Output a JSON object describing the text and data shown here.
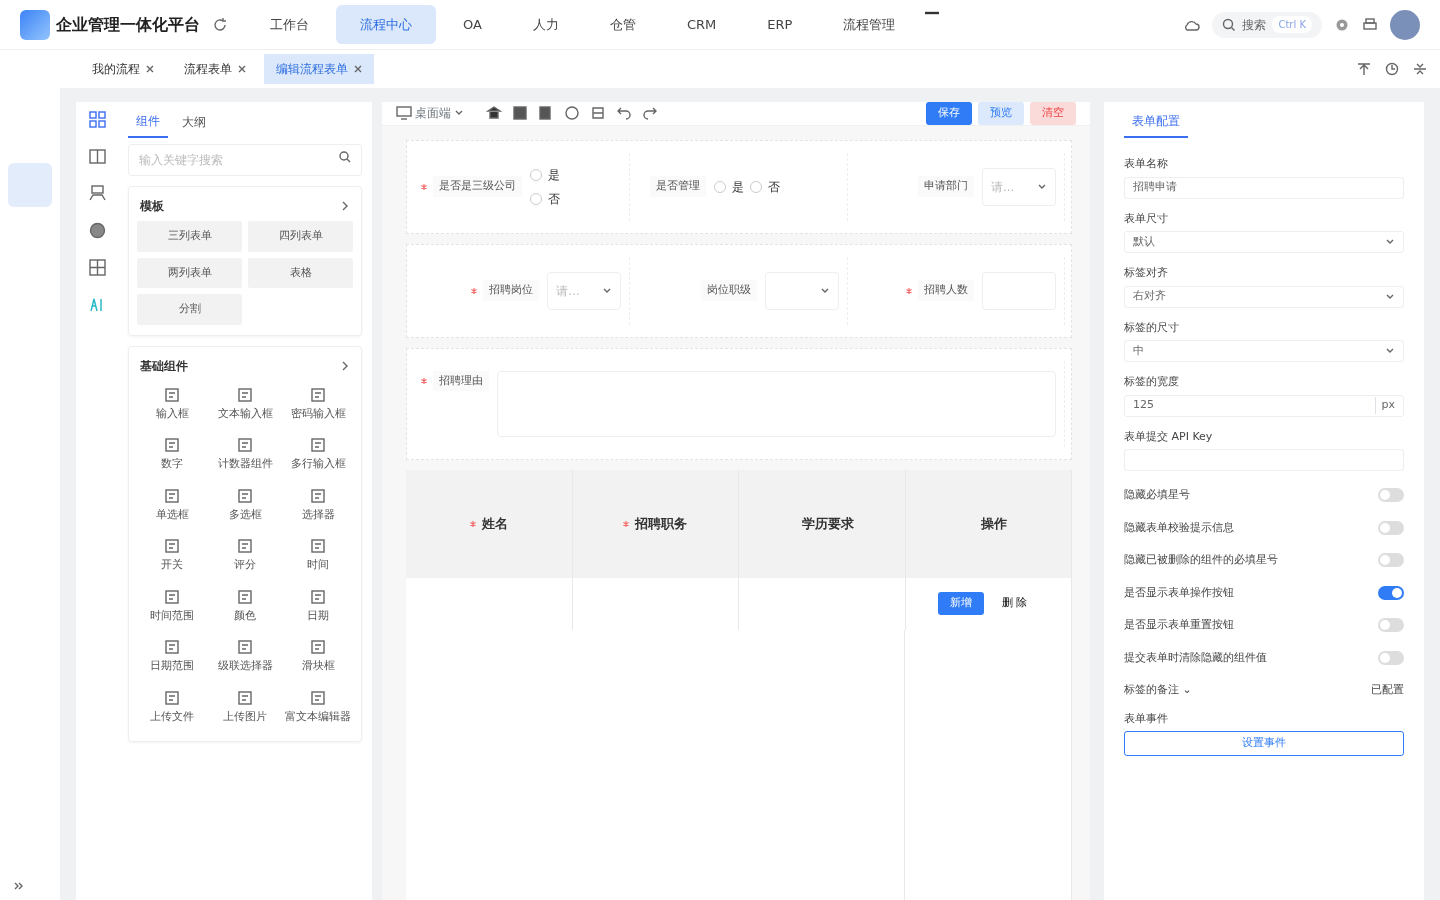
{
  "header": {
    "title": "企业管理一体化平台",
    "nav": [
      {
        "label": "工作台",
        "selected": false
      },
      {
        "label": "流程中心",
        "selected": true
      },
      {
        "label": "OA",
        "selected": false
      },
      {
        "label": "人力",
        "selected": false
      },
      {
        "label": "仓管",
        "selected": false
      },
      {
        "label": "CRM",
        "selected": false
      },
      {
        "label": "ERP",
        "selected": false
      },
      {
        "label": "流程管理",
        "selected": false
      }
    ],
    "search": {
      "placeholder": "搜索",
      "shortcut": "Ctrl K"
    }
  },
  "page_tabs": [
    {
      "label": "我的流程",
      "selected": false
    },
    {
      "label": "流程表单",
      "selected": false
    },
    {
      "label": "编辑流程表单",
      "selected": true
    }
  ],
  "components_panel": {
    "tabs": [
      {
        "label": "组件",
        "selected": true
      },
      {
        "label": "大纲",
        "selected": false
      }
    ],
    "search": {
      "placeholder": "输入关键字搜索"
    },
    "sections": [
      {
        "title": "模板",
        "kind": "buttons",
        "items": [
          "三列表单",
          "四列表单",
          "两列表单",
          "表格",
          "分割"
        ]
      },
      {
        "title": "基础组件",
        "kind": "icons",
        "items": [
          "输入框",
          "文本输入框",
          "密码输入框",
          "数字",
          "计数器组件",
          "多行输入框",
          "单选框",
          "多选框",
          "选择器",
          "开关",
          "评分",
          "时间",
          "时间范围",
          "颜色",
          "日期",
          "日期范围",
          "级联选择器",
          "滑块框",
          "上传文件",
          "上传图片",
          "富文本编辑器"
        ]
      }
    ]
  },
  "designer_toolbar": {
    "device": "桌面端",
    "buttons": [
      {
        "label": "保存",
        "kind": "primary"
      },
      {
        "label": "预览",
        "kind": "info"
      },
      {
        "label": "清空",
        "kind": "danger"
      }
    ]
  },
  "form": {
    "rows": [
      {
        "fields": [
          {
            "kind": "radio",
            "label": "是否是三级公司",
            "required": true,
            "stacked": true,
            "options": [
              {
                "label": "是",
                "selected": false
              },
              {
                "label": "否",
                "selected": false
              }
            ]
          },
          {
            "kind": "radio",
            "label": "是否管理",
            "required": false,
            "stacked": false,
            "options": [
              {
                "label": "是",
                "selected": false
              },
              {
                "label": "否",
                "selected": false
              }
            ]
          },
          {
            "kind": "select",
            "label": "申请部门",
            "required": false,
            "placeholder": "请..."
          }
        ]
      },
      {
        "fields": [
          {
            "kind": "select",
            "label": "招聘岗位",
            "required": true,
            "placeholder": "请..."
          },
          {
            "kind": "select",
            "label": "岗位职级",
            "required": false
          },
          {
            "kind": "input",
            "label": "招聘人数",
            "required": true
          }
        ]
      },
      {
        "fields": [
          {
            "kind": "textarea",
            "label": "招聘理由",
            "required": true
          }
        ]
      }
    ],
    "table": {
      "columns": [
        {
          "label": "姓名",
          "required": true
        },
        {
          "label": "招聘职务",
          "required": true
        },
        {
          "label": "学历要求",
          "required": false
        },
        {
          "label": "操作",
          "required": false
        }
      ],
      "actions": [
        {
          "label": "新增",
          "kind": "primary"
        },
        {
          "label": "删 除",
          "kind": "plain"
        }
      ]
    }
  },
  "properties": {
    "tab": "表单配置",
    "items": [
      {
        "kind": "text",
        "label": "表单名称",
        "value": "招聘申请"
      },
      {
        "kind": "select",
        "label": "表单尺寸",
        "value": "默认"
      },
      {
        "kind": "select",
        "label": "标签对齐",
        "value": "右对齐"
      },
      {
        "kind": "select",
        "label": "标签的尺寸",
        "value": "中"
      },
      {
        "kind": "suffix",
        "label": "标签的宽度",
        "value": "125",
        "suffix": "px"
      },
      {
        "kind": "text",
        "label": "表单提交 API Key"
      },
      {
        "kind": "toggle",
        "label": "隐藏必填星号",
        "on": false
      },
      {
        "kind": "toggle",
        "label": "隐藏表单校验提示信息",
        "on": false
      },
      {
        "kind": "toggle",
        "label": "隐藏已被删除的组件的必填星号",
        "on": false
      },
      {
        "kind": "toggle",
        "label": "是否显示表单操作按钮",
        "on": true
      },
      {
        "kind": "toggle",
        "label": "是否显示表单重置按钮",
        "on": false
      },
      {
        "kind": "toggle",
        "label": "提交表单时清除隐藏的组件值",
        "on": false
      },
      {
        "kind": "link",
        "label": "标签的备注 ⌄",
        "value": "已配置"
      },
      {
        "kind": "button",
        "label": "表单事件",
        "button": "设置事件"
      }
    ]
  }
}
